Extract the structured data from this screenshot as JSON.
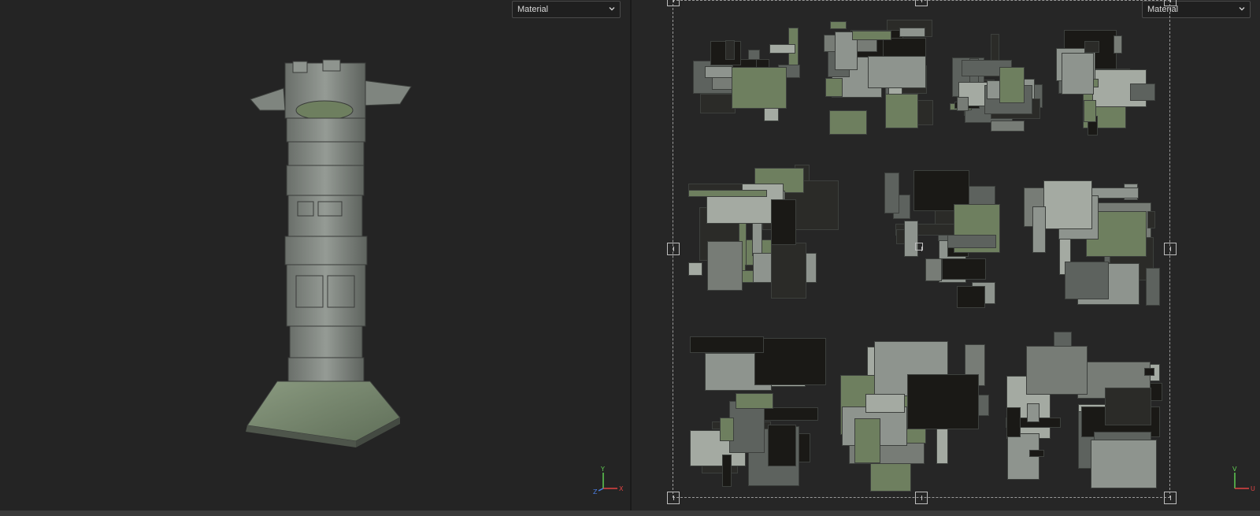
{
  "viewport_3d": {
    "shading_dropdown": {
      "value": "Material"
    },
    "axis_gizmo": {
      "up": "Y",
      "right": "X",
      "depth": "Z"
    }
  },
  "viewport_2d": {
    "shading_dropdown": {
      "value": "Material"
    },
    "axis_gizmo": {
      "up": "V",
      "right": "U"
    }
  },
  "colors": {
    "background": "#242424",
    "stone_light": "#8e948e",
    "stone_mid": "#5d625e",
    "stone_dark": "#2b2b28",
    "moss": "#6e7f5f",
    "axis_x": "#e04343",
    "axis_y": "#5fcc52",
    "axis_z": "#4a7de0"
  },
  "icons": {
    "dropdown": "chevron-down-icon",
    "gizmo3d": "axis-gizmo-3d-icon",
    "gizmo2d": "axis-gizmo-uv-icon"
  }
}
